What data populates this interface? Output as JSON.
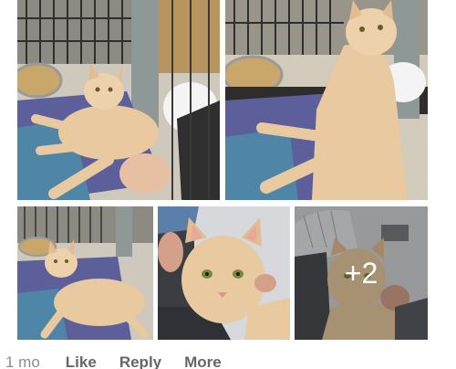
{
  "photos": [
    {
      "name": "cat-photo-1"
    },
    {
      "name": "cat-photo-2"
    },
    {
      "name": "cat-photo-3"
    },
    {
      "name": "cat-photo-4"
    },
    {
      "name": "cat-photo-5"
    }
  ],
  "more_photos_label": "+2",
  "comment_actions": {
    "timestamp": "1 mo",
    "like_label": "Like",
    "reply_label": "Reply",
    "more_label": "More"
  },
  "colors": {
    "cat_fur": "#e8c9a0",
    "blanket_purple": "#6a5c9a",
    "blanket_teal": "#5a8aa8",
    "cage_wire": "#3a3a3a",
    "action_text": "#65676b"
  }
}
